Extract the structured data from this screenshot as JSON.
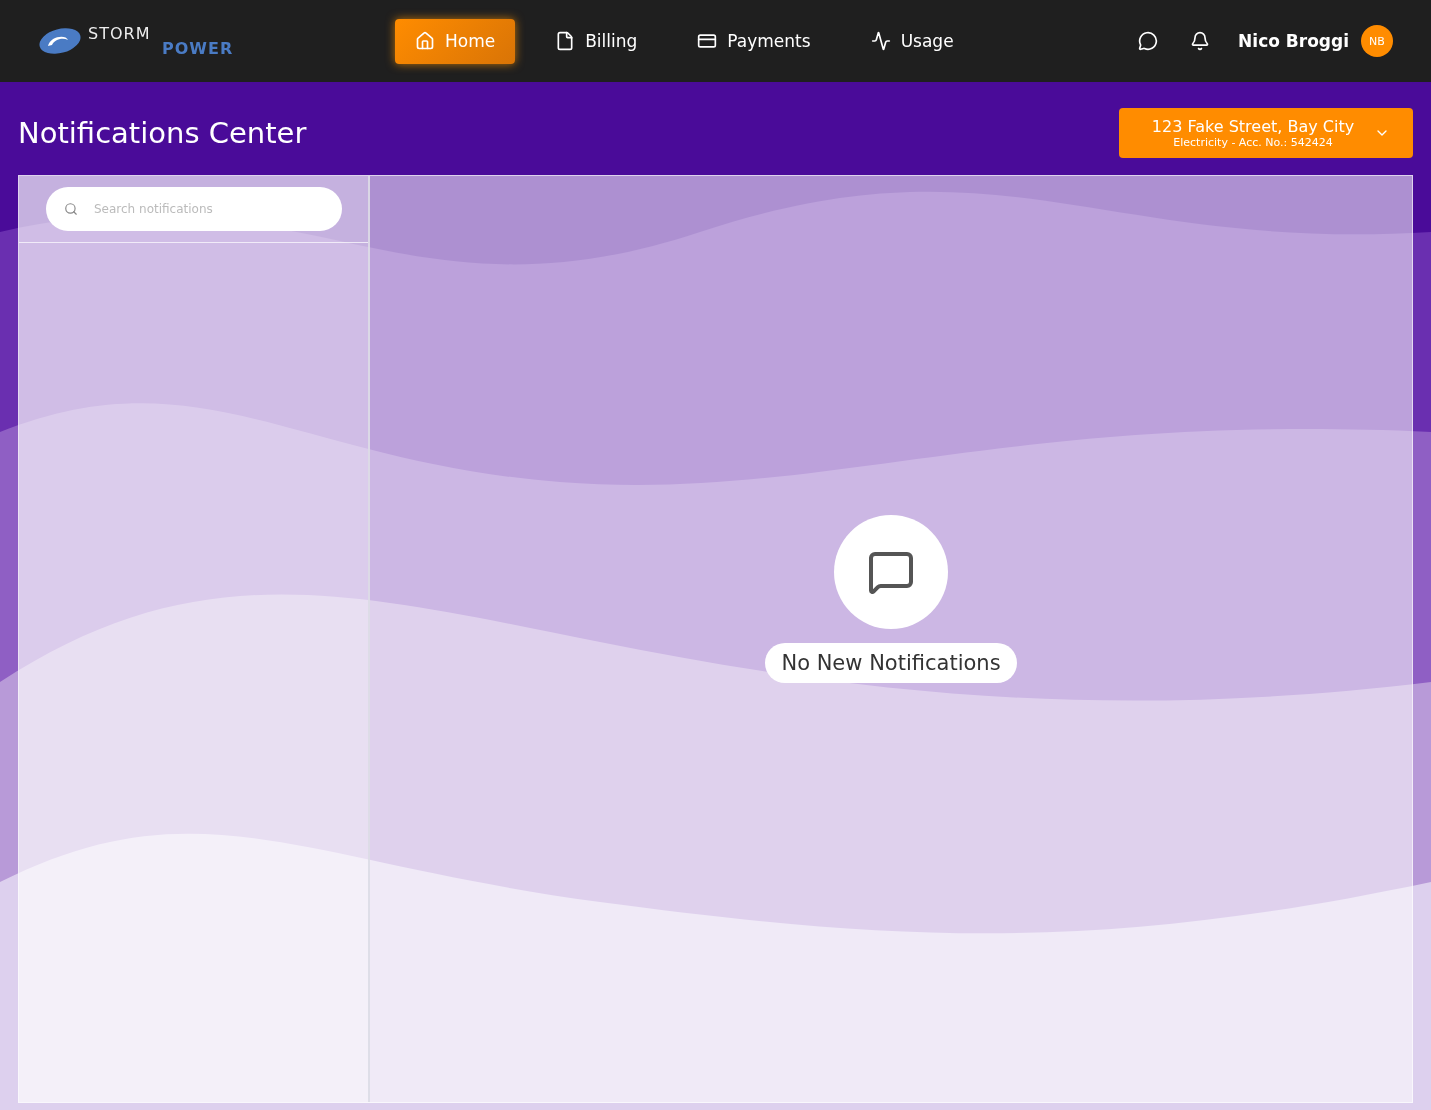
{
  "logo": {
    "line_1": "STORM",
    "line_2": "POWER"
  },
  "nav": [
    {
      "label": "Home",
      "selected": true
    },
    {
      "label": "Billing",
      "selected": false
    },
    {
      "label": "Payments",
      "selected": false
    },
    {
      "label": "Usage",
      "selected": false
    }
  ],
  "user": {
    "name": "Nico Broggi",
    "initials": "NB"
  },
  "page_title": "Notifications Center",
  "account": {
    "address": "123 Fake Street, Bay City",
    "detail": "Electricity - Acc. No.: 542424"
  },
  "search": {
    "placeholder": "Search notifications"
  },
  "empty_state": {
    "message": "No New Notifications"
  }
}
